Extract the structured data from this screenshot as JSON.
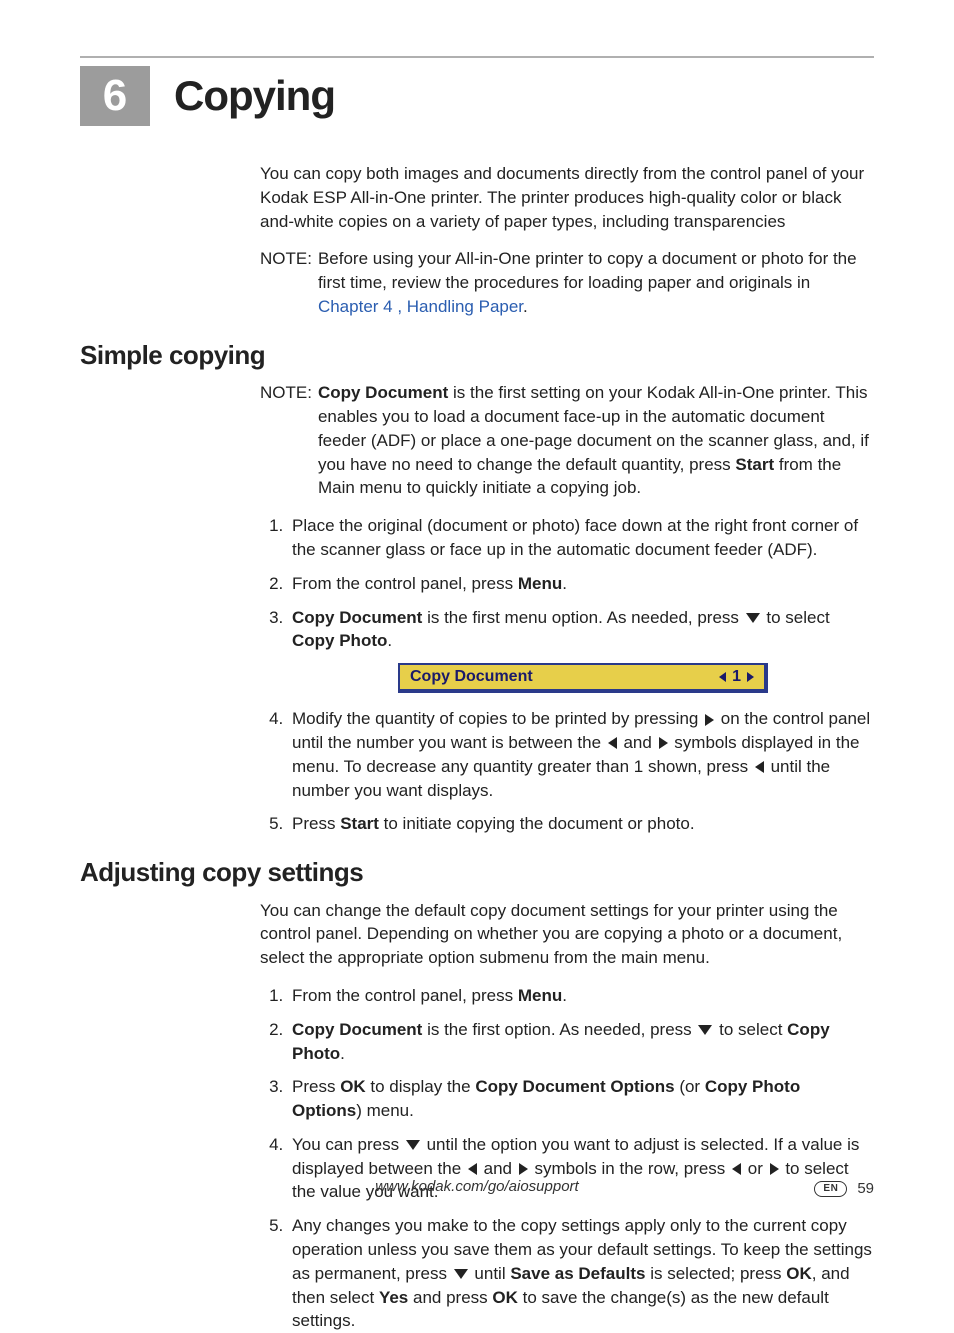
{
  "chapter": {
    "number": "6",
    "title": "Copying"
  },
  "intro": "You can copy both images and documents directly from the control panel of your Kodak ESP All-in-One printer. The printer produces high-quality color or black and-white copies on a variety of paper types, including transparencies",
  "intro_note": {
    "label": "NOTE:",
    "text_before_link": "Before using your All-in-One printer to copy a document or photo for the first time, review the procedures for loading paper and originals in ",
    "link": "Chapter 4 , Handling Paper",
    "text_after_link": "."
  },
  "simple": {
    "title": "Simple copying",
    "note": {
      "label": "NOTE:",
      "bold1": "Copy Document",
      "text1": " is the first setting on your Kodak All-in-One printer. This enables you to load a document face-up in the automatic document feeder (ADF) or place a one-page document on the scanner glass, and, if you have no need to change the default quantity, press ",
      "bold2": "Start",
      "text2": " from the Main menu to quickly initiate a copying job."
    },
    "steps": {
      "s1": "Place the original (document or photo) face down at the right front corner of the scanner glass or face up in the automatic document feeder (ADF).",
      "s2a": "From the control panel, press ",
      "s2b": "Menu",
      "s2c": ".",
      "s3a": "Copy Document",
      "s3b": " is the first menu option. As needed, press ",
      "s3c": " to select ",
      "s3d": "Copy Photo",
      "s3e": ".",
      "s4a": "Modify the quantity of copies to be printed by pressing ",
      "s4b": " on the control panel until the number you want is between the ",
      "s4c": " and ",
      "s4d": " symbols displayed in the menu. To decrease any quantity greater than 1 shown, press ",
      "s4e": " until the number you want displays.",
      "s5a": "Press ",
      "s5b": "Start",
      "s5c": " to initiate copying the document or photo."
    },
    "lcd": {
      "label": "Copy Document",
      "qty": "1"
    }
  },
  "adjust": {
    "title": "Adjusting copy settings",
    "intro": "You can change the default copy document settings for your printer using the control panel. Depending on whether you are copying a photo or a document, select the appropriate option submenu from the main menu.",
    "steps": {
      "s1a": "From the control panel, press ",
      "s1b": "Menu",
      "s1c": ".",
      "s2a": "Copy Document",
      "s2b": " is the first option. As needed, press ",
      "s2c": " to select ",
      "s2d": "Copy Photo",
      "s2e": ".",
      "s3a": "Press ",
      "s3b": "OK",
      "s3c": " to display the ",
      "s3d": "Copy Document Options",
      "s3e": " (or ",
      "s3f": "Copy Photo Options",
      "s3g": ") menu.",
      "s4a": "You can press ",
      "s4b": " until the option you want to adjust is selected. If a value is displayed between the ",
      "s4c": " and ",
      "s4d": " symbols in the row, press ",
      "s4e": " or ",
      "s4f": " to select the value you want.",
      "s5a": "Any changes you make to the copy settings apply only to the current copy operation unless you save them as your default settings. To keep the settings as permanent, press ",
      "s5b": " until ",
      "s5c": "Save as Defaults",
      "s5d": " is selected; press ",
      "s5e": "OK",
      "s5f": ", and then select ",
      "s5g": "Yes",
      "s5h": " and press ",
      "s5i": "OK",
      "s5j": " to save the change(s) as the new default settings."
    }
  },
  "footer": {
    "url": "www.kodak.com/go/aiosupport",
    "lang": "EN",
    "page": "59"
  }
}
